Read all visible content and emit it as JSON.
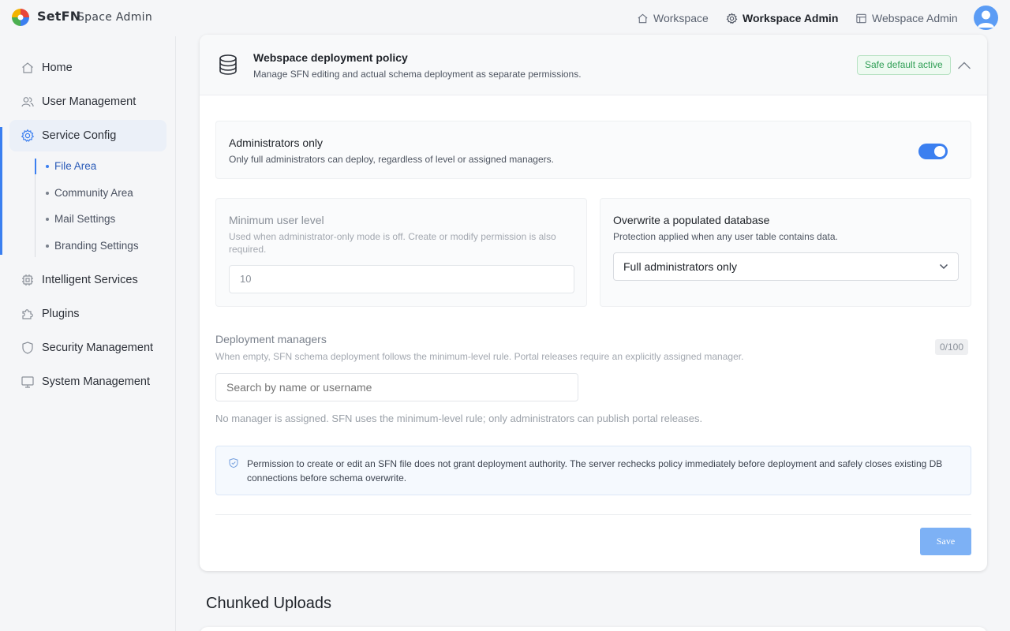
{
  "app": {
    "brand": "SetFN",
    "subtitle": "Space Admin"
  },
  "topnav": [
    {
      "label": "Workspace",
      "icon": "home-icon"
    },
    {
      "label": "Workspace Admin",
      "icon": "gear-icon",
      "active": true
    },
    {
      "label": "Webspace Admin",
      "icon": "layout-icon"
    }
  ],
  "sidebar": {
    "items": [
      {
        "label": "Home",
        "icon": "home-icon"
      },
      {
        "label": "User Management",
        "icon": "users-icon"
      },
      {
        "label": "Service Config",
        "icon": "gear-icon",
        "active": true
      },
      {
        "label": "Intelligent Services",
        "icon": "chip-icon"
      },
      {
        "label": "Plugins",
        "icon": "puzzle-icon"
      },
      {
        "label": "Security Management",
        "icon": "shield-icon"
      },
      {
        "label": "System Management",
        "icon": "monitor-icon"
      }
    ],
    "subitems": [
      {
        "label": "File Area",
        "active": true
      },
      {
        "label": "Community Area"
      },
      {
        "label": "Mail Settings"
      },
      {
        "label": "Branding Settings"
      }
    ]
  },
  "policy": {
    "title": "Webspace deployment policy",
    "description": "Manage SFN editing and actual schema deployment as separate permissions.",
    "badge": "Safe default active",
    "admin_only": {
      "title": "Administrators only",
      "description": "Only full administrators can deploy, regardless of level or assigned managers.",
      "enabled": true
    },
    "min_level": {
      "title": "Minimum user level",
      "description": "Used when administrator-only mode is off. Create or modify permission is also required.",
      "value": "10"
    },
    "overwrite": {
      "title": "Overwrite a populated database",
      "description": "Protection applied when any user table contains data.",
      "selected": "Full administrators only"
    },
    "managers": {
      "title": "Deployment managers",
      "description": "When empty, SFN schema deployment follows the minimum-level rule. Portal releases require an explicitly assigned manager.",
      "counter": "0/100",
      "search_placeholder": "Search by name or username",
      "empty_message": "No manager is assigned. SFN uses the minimum-level rule; only administrators can publish portal releases."
    },
    "note": "Permission to create or edit an SFN file does not grant deployment authority. The server rechecks policy immediately before deployment and safely closes existing DB connections before schema overwrite.",
    "save_label": "Save"
  },
  "next_section": {
    "title": "Chunked Uploads"
  },
  "colors": {
    "accent": "#3b7ff0",
    "success": "#2f9e55",
    "save_button": "#7db1f5"
  }
}
